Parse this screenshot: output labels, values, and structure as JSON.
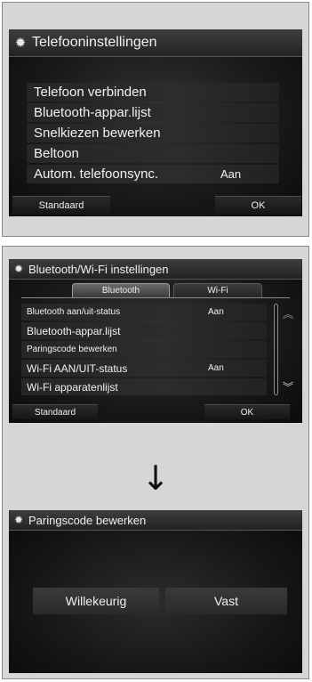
{
  "phone_settings": {
    "title": "Telefooninstellingen",
    "items": [
      {
        "label": "Telefoon verbinden"
      },
      {
        "label": "Bluetooth-appar.lijst"
      },
      {
        "label": "Snelkiezen bewerken"
      },
      {
        "label": "Beltoon"
      },
      {
        "label": "Autom. telefoonsync.",
        "value": "Aan"
      }
    ],
    "default_button": "Standaard",
    "ok_button": "OK"
  },
  "bt_wifi_settings": {
    "title": "Bluetooth/Wi-Fi instellingen",
    "tabs": [
      "Bluetooth",
      "Wi-Fi"
    ],
    "items": [
      {
        "label": "Bluetooth aan/uit-status",
        "value": "Aan"
      },
      {
        "label": "Bluetooth-appar.lijst"
      },
      {
        "label": "Paringscode bewerken"
      },
      {
        "label": "Wi-Fi AAN/UIT-status",
        "value": "Aan"
      },
      {
        "label": "Wi-Fi apparatenlijst"
      }
    ],
    "default_button": "Standaard",
    "ok_button": "OK",
    "icons": {
      "settings": "gear-icon",
      "scroll_up": "chevron-up-icon",
      "scroll_down": "chevron-down-icon"
    }
  },
  "flow_arrow": "↓",
  "pairing_code": {
    "title": "Paringscode bewerken",
    "options": [
      "Willekeurig",
      "Vast"
    ]
  }
}
